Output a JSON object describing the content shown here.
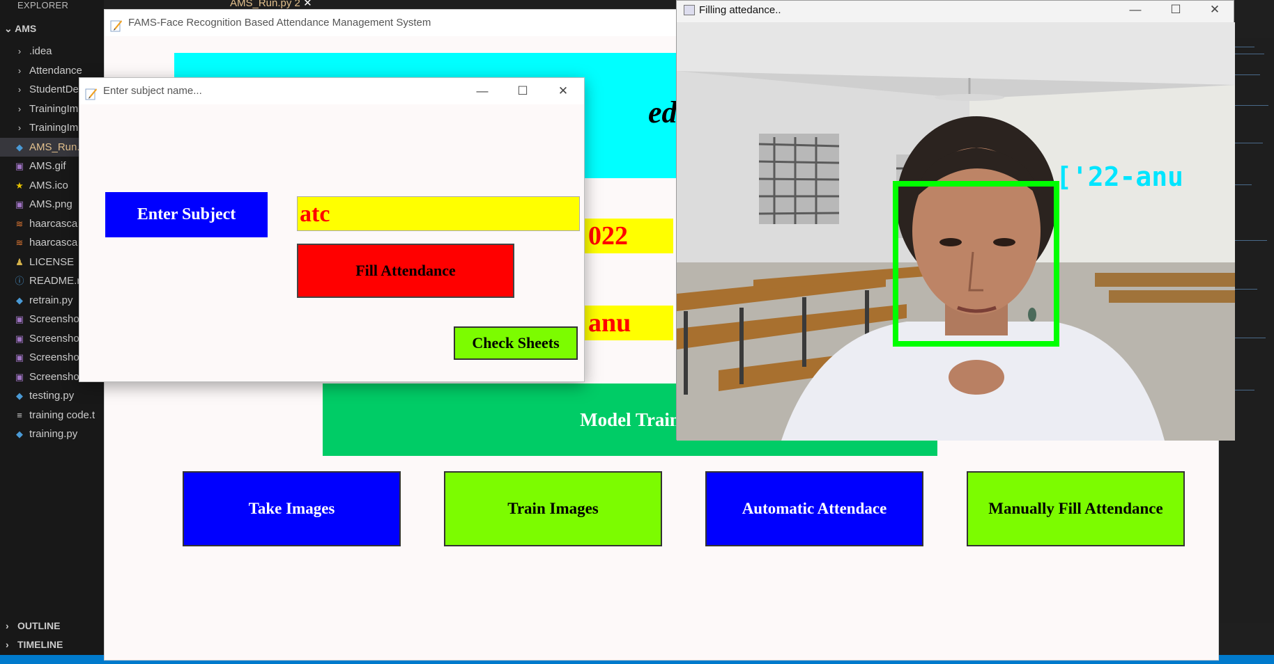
{
  "explorer": {
    "header": "EXPLORER",
    "more": "···",
    "root": "AMS",
    "items": [
      {
        "label": ".idea",
        "icon": "chevron-right-icon"
      },
      {
        "label": "Attendance",
        "icon": "chevron-right-icon"
      },
      {
        "label": "StudentDe",
        "icon": "chevron-right-icon"
      },
      {
        "label": "TrainingIm",
        "icon": "chevron-right-icon"
      },
      {
        "label": "TrainingIm",
        "icon": "chevron-right-icon"
      },
      {
        "label": "AMS_Run.",
        "icon": "python-file-icon"
      },
      {
        "label": "AMS.gif",
        "icon": "image-file-icon"
      },
      {
        "label": "AMS.ico",
        "icon": "star-icon"
      },
      {
        "label": "AMS.png",
        "icon": "image-file-icon"
      },
      {
        "label": "haarcasca",
        "icon": "rss-icon"
      },
      {
        "label": "haarcasca",
        "icon": "rss-icon"
      },
      {
        "label": "LICENSE",
        "icon": "license-icon"
      },
      {
        "label": "README.r",
        "icon": "info-icon"
      },
      {
        "label": "retrain.py",
        "icon": "python-file-icon"
      },
      {
        "label": "Screensho",
        "icon": "image-file-icon"
      },
      {
        "label": "Screensho",
        "icon": "image-file-icon"
      },
      {
        "label": "Screensho",
        "icon": "image-file-icon"
      },
      {
        "label": "Screensho",
        "icon": "image-file-icon"
      },
      {
        "label": "testing.py",
        "icon": "python-file-icon"
      },
      {
        "label": "training code.t",
        "icon": "text-file-icon"
      },
      {
        "label": "training.py",
        "icon": "python-file-icon"
      }
    ],
    "outline": "OUTLINE",
    "timeline": "TIMELINE"
  },
  "editor": {
    "tab": "AMS_Run.py 2"
  },
  "main_window": {
    "title": "FAMS-Face Recognition Based Attendance Management System",
    "banner_text": "ed-Atte",
    "field1": "022",
    "field2": "anu",
    "model_train": "Model Train",
    "buttons": {
      "take_images": "Take Images",
      "train_images": "Train Images",
      "automatic": "Automatic Attendace",
      "manual": "Manually Fill Attendance"
    }
  },
  "subject_dialog": {
    "title": "Enter subject name...",
    "enter_subject_label": "Enter Subject",
    "subject_value": "atc",
    "fill_attendance": "Fill Attendance",
    "check_sheets": "Check Sheets"
  },
  "camera_window": {
    "title": "Filling attedance..",
    "face_label": "['22-anu"
  },
  "colors": {
    "cyan": "#00ffff",
    "yellow": "#ffff00",
    "red": "#ff0000",
    "blue": "#0000ff",
    "lime": "#7cfc00",
    "green": "#00cc66",
    "face_box": "#00ff00"
  }
}
